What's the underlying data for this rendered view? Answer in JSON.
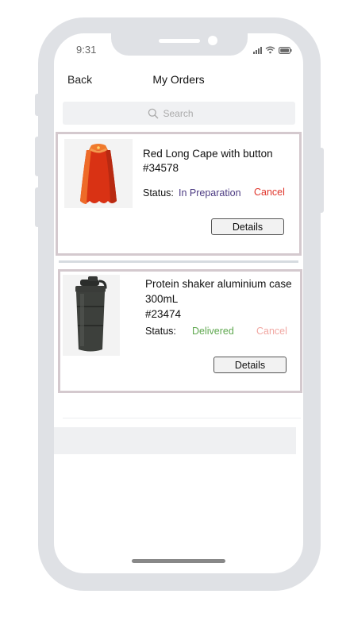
{
  "status_bar": {
    "time": "9:31"
  },
  "header": {
    "back_label": "Back",
    "title": "My Orders"
  },
  "search": {
    "placeholder": "Search"
  },
  "orders": [
    {
      "name": "Red Long Cape with button",
      "number": "#34578",
      "status_label": "Status:",
      "status": "In Preparation",
      "cancel_label": "Cancel",
      "details_label": "Details"
    },
    {
      "name": "Protein shaker aluminium case 300mL",
      "number": "#23474",
      "status_label": "Status:",
      "status": "Delivered",
      "cancel_label": "Cancel",
      "details_label": "Details"
    }
  ],
  "colors": {
    "in_preparation": "#4b3a82",
    "delivered": "#5fa84f",
    "cancel": "#e0352b",
    "cancel_disabled": "#f1a8a3",
    "card_border": "#d4c9ce",
    "frame": "#dfe1e5"
  },
  "icons": {
    "search": "search-icon",
    "signal": "signal-icon",
    "wifi": "wifi-icon",
    "battery": "battery-icon"
  }
}
